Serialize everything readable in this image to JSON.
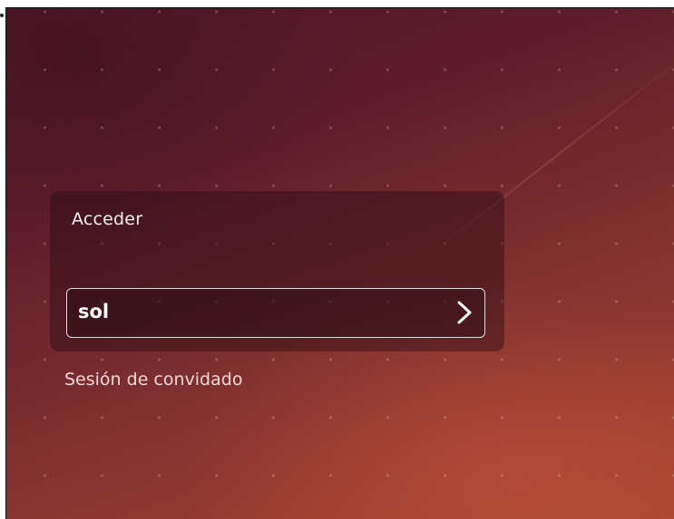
{
  "login": {
    "title": "Acceder",
    "selected_user": "sol",
    "guest_session_label": "Sesión de convidado"
  },
  "icons": {
    "submit": "chevron-right-icon"
  },
  "colors": {
    "background_top": "#4f1627",
    "background_bottom": "#a4462f",
    "text": "#f3ecee"
  }
}
